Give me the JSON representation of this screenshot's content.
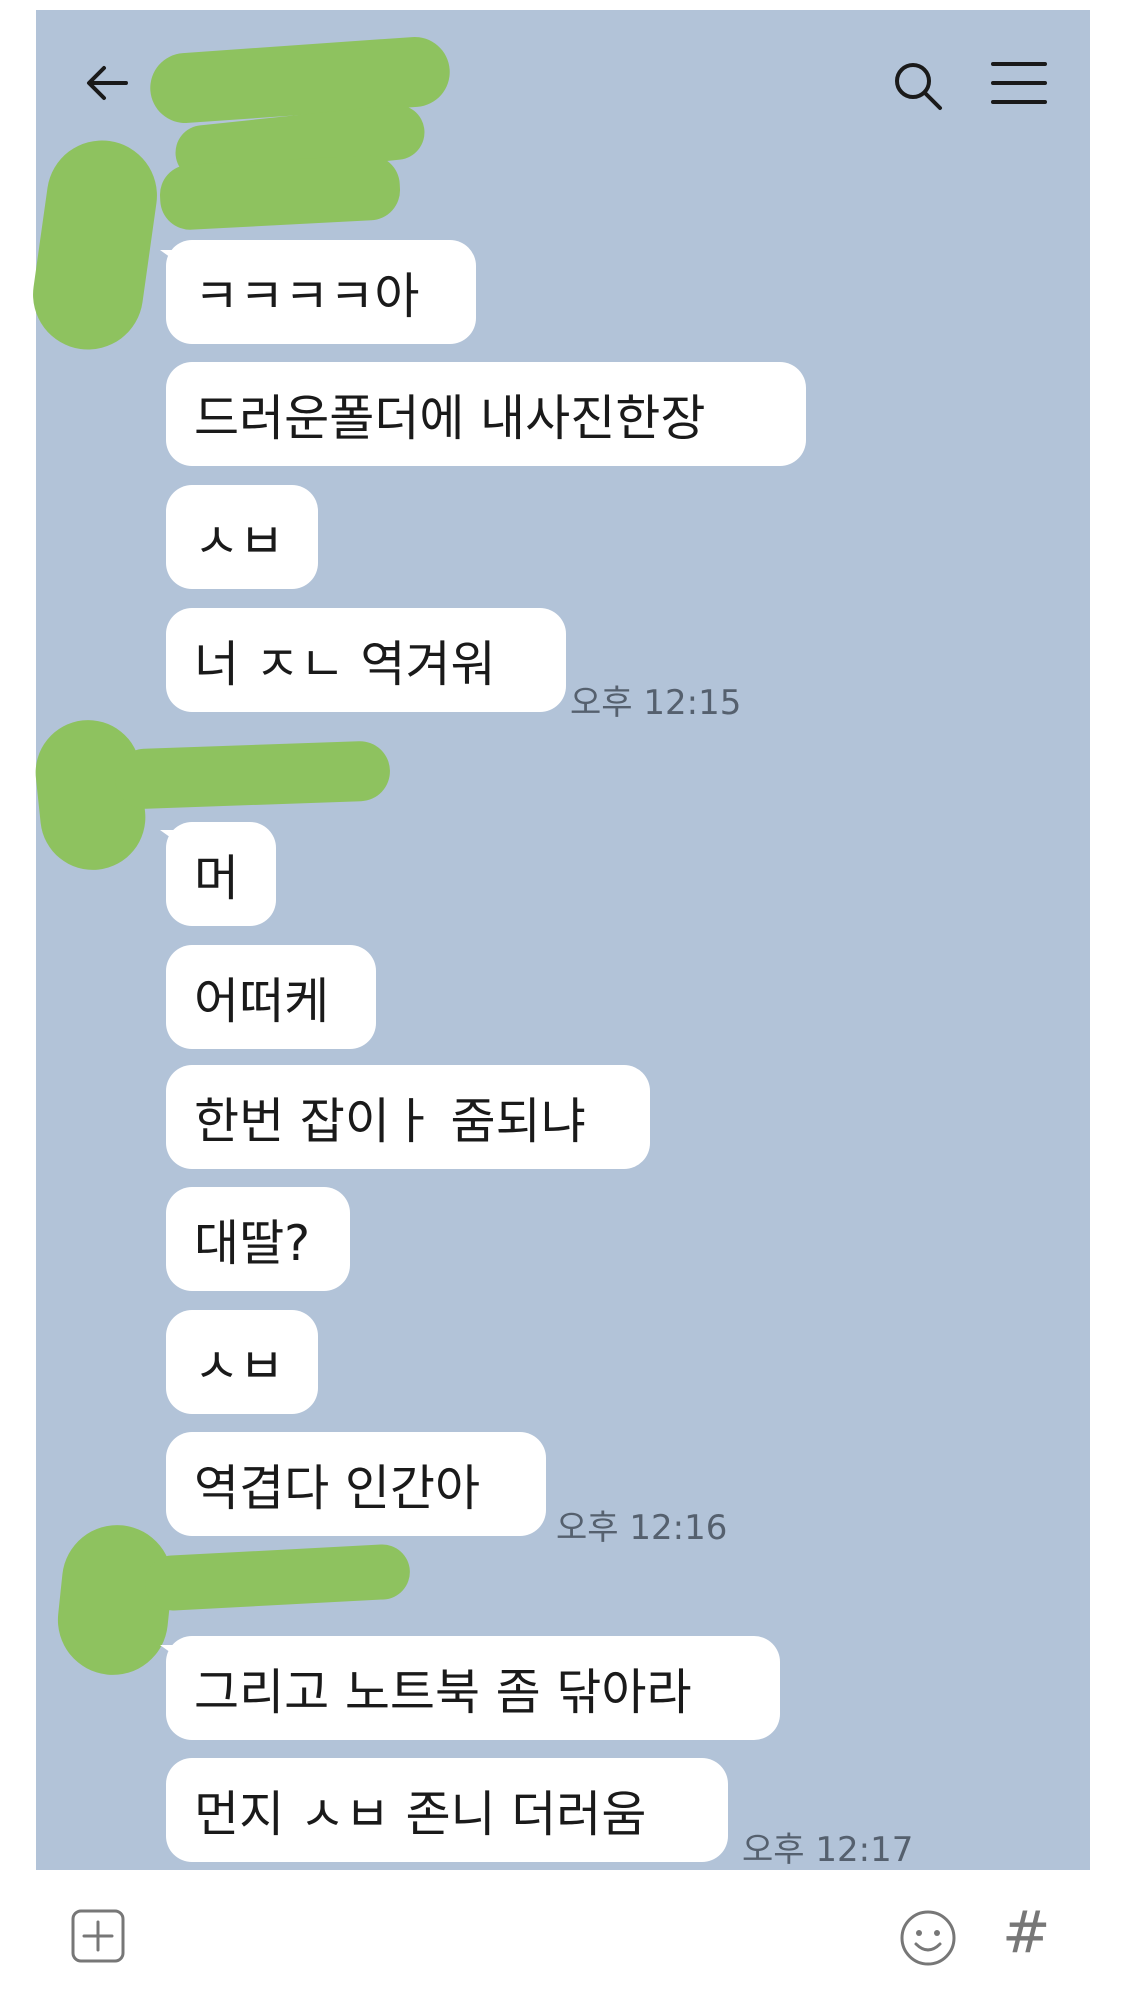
{
  "header": {
    "back_icon": "back-arrow-icon",
    "search_icon": "search-icon",
    "menu_icon": "hamburger-menu-icon"
  },
  "messages": [
    {
      "text": "ㅋㅋㅋㅋ아"
    },
    {
      "text": "드러운폴더에 내사진한장"
    },
    {
      "text": "ㅅㅂ"
    },
    {
      "text": "너 ㅈㄴ 역겨워",
      "time": "오후 12:15"
    },
    {
      "text": "머"
    },
    {
      "text": "어떠케"
    },
    {
      "text": "한번 잡이ㅏ 줌되냐"
    },
    {
      "text": "대딸?"
    },
    {
      "text": "ㅅㅂ"
    },
    {
      "text": "역겹다 인간아",
      "time": "오후 12:16"
    },
    {
      "text": "그리고 노트북 좀 닦아라"
    },
    {
      "text": "먼지 ㅅㅂ 존니 더러움",
      "time": "오후 12:17"
    }
  ],
  "input_bar": {
    "add_icon": "plus-box-icon",
    "emoji_icon": "emoji-icon",
    "hash_symbol": "#"
  },
  "colors": {
    "chat_background": "#b2c3d8",
    "bubble": "#ffffff",
    "redaction": "#8ec25f"
  }
}
